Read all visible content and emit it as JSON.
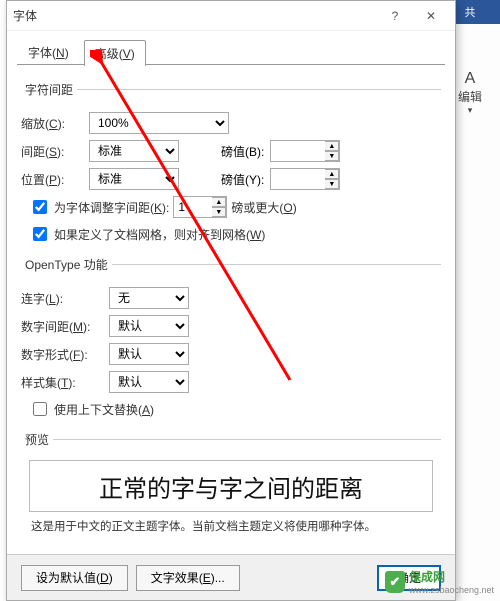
{
  "window": {
    "title": "字体"
  },
  "ribbon": {
    "share": "共",
    "edit_label": "编辑"
  },
  "tabs": {
    "font": {
      "label": "字体",
      "hotkey": "N"
    },
    "advanced": {
      "label": "高级",
      "hotkey": "V"
    }
  },
  "group_spacing": {
    "legend": "字符间距",
    "scale": {
      "label": "缩放",
      "hotkey": "C",
      "value": "100%"
    },
    "spacing": {
      "label": "间距",
      "hotkey": "S",
      "value": "标准",
      "pt_label": "磅值",
      "pt_hotkey": "B",
      "pt_value": ""
    },
    "position": {
      "label": "位置",
      "hotkey": "P",
      "value": "标准",
      "pt_label": "磅值",
      "pt_hotkey": "Y",
      "pt_value": ""
    },
    "kerning": {
      "label": "为字体调整字间距",
      "hotkey": "K",
      "value": "1",
      "suffix": "磅或更大",
      "suffix_hotkey": "O",
      "checked": true
    },
    "snapgrid": {
      "label": "如果定义了文档网格，则对齐到网格",
      "hotkey": "W",
      "checked": true
    }
  },
  "group_opentype": {
    "legend": "OpenType 功能",
    "ligature": {
      "label": "连字",
      "hotkey": "L",
      "value": "无"
    },
    "numspacing": {
      "label": "数字间距",
      "hotkey": "M",
      "value": "默认"
    },
    "numform": {
      "label": "数字形式",
      "hotkey": "F",
      "value": "默认"
    },
    "styleset": {
      "label": "样式集",
      "hotkey": "T",
      "value": "默认"
    },
    "context": {
      "label": "使用上下文替换",
      "hotkey": "A",
      "checked": false
    }
  },
  "preview": {
    "legend": "预览",
    "sample": "正常的字与字之间的距离",
    "note": "这是用于中文的正文主题字体。当前文档主题定义将使用哪种字体。"
  },
  "buttons": {
    "default": {
      "label": "设为默认值",
      "hotkey": "D"
    },
    "effects": {
      "label": "文字效果",
      "hotkey": "E"
    },
    "ok": "确定"
  },
  "watermark": {
    "text": "保成网",
    "url": "www.zsbaocheng.net"
  }
}
